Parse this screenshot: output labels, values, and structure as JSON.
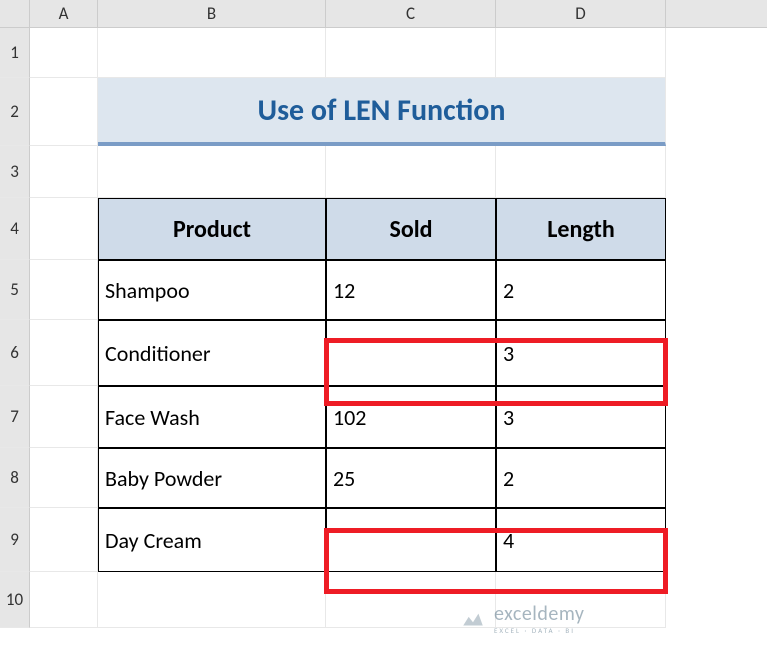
{
  "columns": {
    "A": "A",
    "B": "B",
    "C": "C",
    "D": "D"
  },
  "rows": {
    "r1": "1",
    "r2": "2",
    "r3": "3",
    "r4": "4",
    "r5": "5",
    "r6": "6",
    "r7": "7",
    "r8": "8",
    "r9": "9",
    "r10": "10"
  },
  "title": "Use of LEN Function",
  "headers": {
    "product": "Product",
    "sold": "Sold",
    "length": "Length"
  },
  "data": [
    {
      "product": "Shampoo",
      "sold": "12",
      "length": "2"
    },
    {
      "product": "Conditioner",
      "sold": "",
      "length": "3"
    },
    {
      "product": "Face Wash",
      "sold": "102",
      "length": "3"
    },
    {
      "product": "Baby Powder",
      "sold": "25",
      "length": "2"
    },
    {
      "product": "Day Cream",
      "sold": "",
      "length": "4"
    }
  ],
  "watermark": {
    "name": "exceldemy",
    "tag": "EXCEL · DATA · BI"
  }
}
